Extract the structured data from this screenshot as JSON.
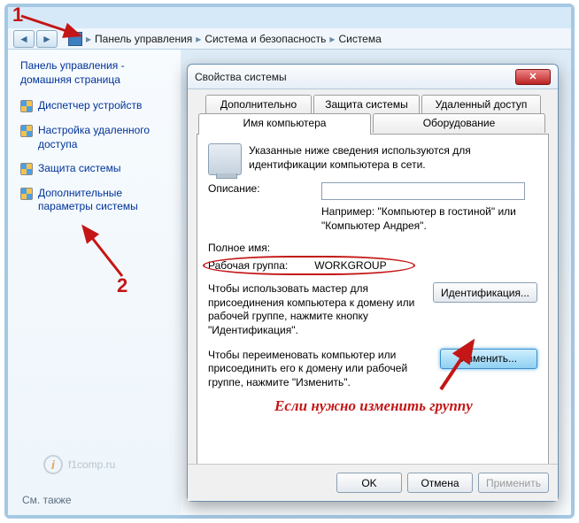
{
  "breadcrumb": {
    "root": "Панель управления",
    "l1": "Система и безопасность",
    "l2": "Система"
  },
  "sidebar": {
    "heading": "Панель управления - домашняя страница",
    "items": [
      {
        "label": "Диспетчер устройств"
      },
      {
        "label": "Настройка удаленного доступа"
      },
      {
        "label": "Защита системы"
      },
      {
        "label": "Дополнительные параметры системы"
      }
    ],
    "footer": "См. также"
  },
  "watermark": "f1comp.ru",
  "dialog": {
    "title": "Свойства системы",
    "tabs_row1": [
      "Дополнительно",
      "Защита системы",
      "Удаленный доступ"
    ],
    "tabs_row2": [
      "Имя компьютера",
      "Оборудование"
    ],
    "info": "Указанные ниже сведения используются для идентификации компьютера в сети.",
    "desc_label": "Описание:",
    "desc_value": "",
    "desc_hint": "Например: \"Компьютер в гостиной\" или \"Компьютер Андрея\".",
    "fullname_label": "Полное имя:",
    "fullname_value": "",
    "workgroup_label": "Рабочая группа:",
    "workgroup_value": "WORKGROUP",
    "para_ident": "Чтобы использовать мастер для присоединения компьютера к домену или рабочей группе, нажмите кнопку \"Идентификация\".",
    "btn_ident": "Идентификация...",
    "para_change": "Чтобы переименовать компьютер или присоединить его к домену или рабочей группе, нажмите \"Изменить\".",
    "btn_change": "Изменить...",
    "ok": "OK",
    "cancel": "Отмена",
    "apply": "Применить"
  },
  "annotations": {
    "n1": "1",
    "n2": "2",
    "note": "Если нужно изменить группу"
  }
}
